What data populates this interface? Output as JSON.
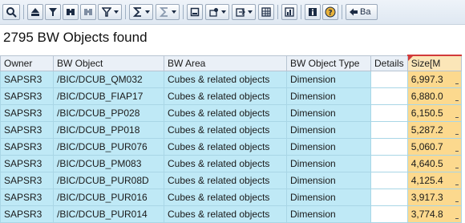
{
  "toolbar": {
    "buttons": [
      {
        "icon": "details-magnifier-icon"
      },
      {
        "icon": "sort-ascending-icon"
      },
      {
        "icon": "filter-icon"
      },
      {
        "icon": "find-icon"
      },
      {
        "icon": "find-next-icon"
      },
      {
        "icon": "set-filter-icon"
      },
      {
        "icon": "total-sum-icon"
      },
      {
        "icon": "subtotal-icon"
      },
      {
        "icon": "print-preview-icon"
      },
      {
        "icon": "view-icon"
      },
      {
        "icon": "export-icon"
      },
      {
        "icon": "layout-grid-icon"
      },
      {
        "icon": "graphic-icon"
      },
      {
        "icon": "information-icon"
      },
      {
        "icon": "help-icon"
      },
      {
        "icon": "back-arrow-icon",
        "label": "Ba"
      }
    ]
  },
  "title": "2795 BW Objects found",
  "table": {
    "headers": [
      "Owner",
      "BW Object",
      "BW Area",
      "BW Object Type",
      "Details",
      "Size[M"
    ],
    "rows": [
      [
        "SAPSR3",
        "/BIC/DCUB_QM032",
        "Cubes & related objects",
        "Dimension",
        "",
        "6,997.3"
      ],
      [
        "SAPSR3",
        "/BIC/DCUB_FIAP17",
        "Cubes & related objects",
        "Dimension",
        "",
        "6,880.0"
      ],
      [
        "SAPSR3",
        "/BIC/DCUB_PP028",
        "Cubes & related objects",
        "Dimension",
        "",
        "6,150.5"
      ],
      [
        "SAPSR3",
        "/BIC/DCUB_PP018",
        "Cubes & related objects",
        "Dimension",
        "",
        "5,287.2"
      ],
      [
        "SAPSR3",
        "/BIC/DCUB_PUR076",
        "Cubes & related objects",
        "Dimension",
        "",
        "5,060.7"
      ],
      [
        "SAPSR3",
        "/BIC/DCUB_PM083",
        "Cubes & related objects",
        "Dimension",
        "",
        "4,640.5"
      ],
      [
        "SAPSR3",
        "/BIC/DCUB_PUR08D",
        "Cubes & related objects",
        "Dimension",
        "",
        "4,125.4"
      ],
      [
        "SAPSR3",
        "/BIC/DCUB_PUR016",
        "Cubes & related objects",
        "Dimension",
        "",
        "3,917.3"
      ],
      [
        "SAPSR3",
        "/BIC/DCUB_PUR014",
        "Cubes & related objects",
        "Dimension",
        "",
        "3,774.8"
      ]
    ]
  },
  "colors": {
    "row_bg": "#bfe9f6",
    "size_col_bg": "#fcd98e",
    "header_bg": "#eaf0f7",
    "sort_marker": "#d23a3a"
  }
}
